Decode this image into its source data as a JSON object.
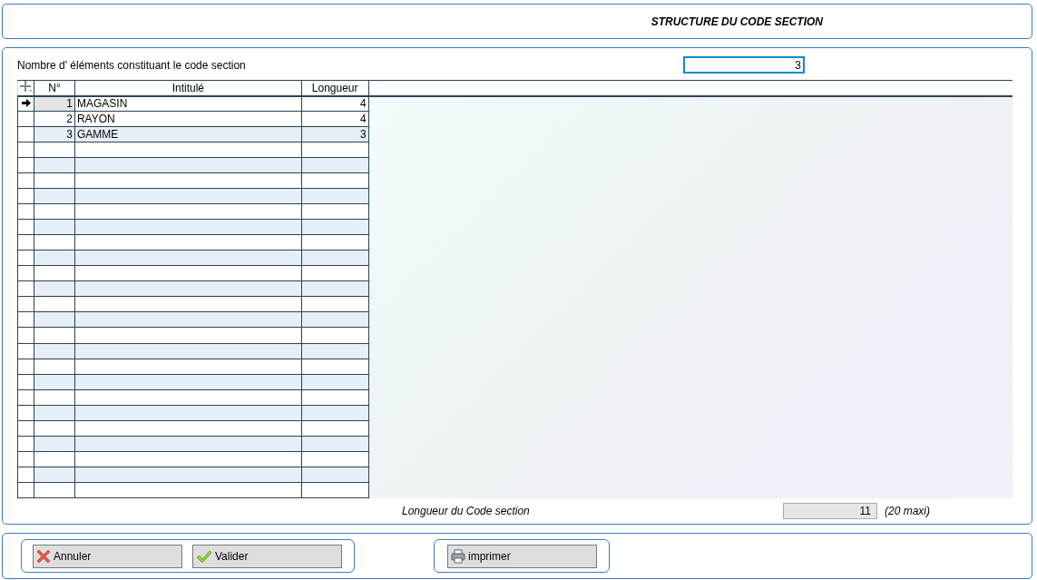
{
  "header": {
    "title": "STRUCTURE DU CODE SECTION"
  },
  "count_field": {
    "label": "Nombre d' éléments constituant le code section",
    "value": "3"
  },
  "table": {
    "columns": [
      "N°",
      "Intitulé",
      "Longueur"
    ],
    "rows": [
      {
        "number": "1",
        "label": "MAGASIN",
        "length": "4",
        "selected": true
      },
      {
        "number": "2",
        "label": "RAYON",
        "length": "4",
        "selected": false
      },
      {
        "number": "3",
        "label": "GAMME",
        "length": "3",
        "selected": false
      }
    ]
  },
  "total": {
    "label": "Longueur du Code section",
    "value": "11",
    "note": "(20 maxi)"
  },
  "buttons": [
    {
      "label": "Annuler",
      "kind": "cancel"
    },
    {
      "label": "Valider",
      "kind": "ok"
    }
  ],
  "print_button": {
    "label": "imprimer",
    "kind": "print"
  }
}
